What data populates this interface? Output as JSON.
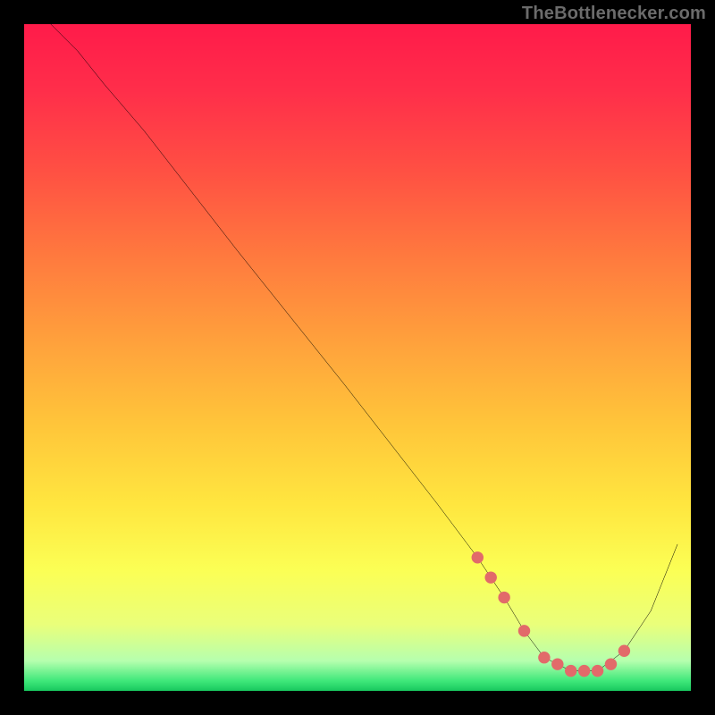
{
  "watermark": "TheBottlenecker.com",
  "chart_data": {
    "type": "line",
    "title": "",
    "xlabel": "",
    "ylabel": "",
    "xlim": [
      0,
      100
    ],
    "ylim": [
      0,
      100
    ],
    "grid": false,
    "series": [
      {
        "name": "bottleneck-curve",
        "x": [
          4,
          8,
          12,
          18,
          25,
          32,
          40,
          48,
          55,
          62,
          68,
          72,
          75,
          78,
          82,
          86,
          90,
          94,
          98
        ],
        "values": [
          100,
          96,
          91,
          84,
          75,
          66,
          56,
          46,
          37,
          28,
          20,
          14,
          9,
          5,
          3,
          3,
          6,
          12,
          22
        ]
      }
    ],
    "markers": {
      "name": "dotted-valley-markers",
      "color": "#e26a6a",
      "x": [
        68,
        70,
        72,
        75,
        78,
        80,
        82,
        84,
        86,
        88,
        90
      ],
      "values": [
        20,
        17,
        14,
        9,
        5,
        4,
        3,
        3,
        3,
        4,
        6
      ]
    },
    "gradient_stops": [
      {
        "offset": 0.0,
        "color": "#ff1b4a"
      },
      {
        "offset": 0.1,
        "color": "#ff2e4a"
      },
      {
        "offset": 0.22,
        "color": "#ff5043"
      },
      {
        "offset": 0.35,
        "color": "#ff7a3e"
      },
      {
        "offset": 0.48,
        "color": "#ffa23c"
      },
      {
        "offset": 0.6,
        "color": "#ffc53a"
      },
      {
        "offset": 0.72,
        "color": "#ffe63f"
      },
      {
        "offset": 0.82,
        "color": "#fbff55"
      },
      {
        "offset": 0.9,
        "color": "#eaff7a"
      },
      {
        "offset": 0.955,
        "color": "#b6ffae"
      },
      {
        "offset": 0.985,
        "color": "#3fe87a"
      },
      {
        "offset": 1.0,
        "color": "#18c85e"
      }
    ]
  }
}
